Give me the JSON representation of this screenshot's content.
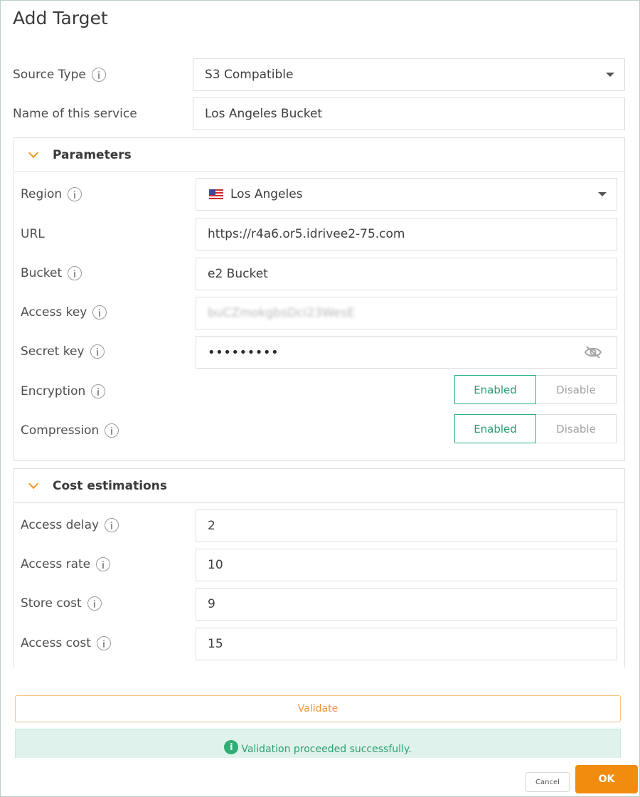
{
  "dialog": {
    "title": "Add Target"
  },
  "source_type": {
    "label": "Source Type",
    "value": "S3 Compatible"
  },
  "service_name": {
    "label": "Name of this service",
    "value": "Los Angeles Bucket"
  },
  "parameters": {
    "heading": "Parameters",
    "region": {
      "label": "Region",
      "value": "Los Angeles",
      "flag": "us-flag-icon"
    },
    "url": {
      "label": "URL",
      "value": "https://r4a6.or5.idrivee2-75.com"
    },
    "bucket": {
      "label": "Bucket",
      "value": "e2 Bucket"
    },
    "access_key": {
      "label": "Access key",
      "value": "buCZmokgbsDci23WesE"
    },
    "secret_key": {
      "label": "Secret key",
      "value": "•••••••••",
      "icon": "eye-slash-icon"
    },
    "encryption": {
      "label": "Encryption",
      "enabled_label": "Enabled",
      "disable_label": "Disable",
      "selected": "Enabled"
    },
    "compression": {
      "label": "Compression",
      "enabled_label": "Enabled",
      "disable_label": "Disable",
      "selected": "Enabled"
    }
  },
  "cost": {
    "heading": "Cost estimations",
    "access_delay": {
      "label": "Access delay",
      "value": "2"
    },
    "access_rate": {
      "label": "Access rate",
      "value": "10"
    },
    "store_cost": {
      "label": "Store cost",
      "value": "9"
    },
    "access_cost": {
      "label": "Access cost",
      "value": "15"
    }
  },
  "footer": {
    "validate_label": "Validate",
    "success_message": "Validation proceeded successfully.",
    "cancel_label": "Cancel",
    "ok_label": "OK"
  },
  "colors": {
    "accent": "#f28c0f",
    "success": "#2eaf7d",
    "success_bg": "#dff2ec"
  }
}
